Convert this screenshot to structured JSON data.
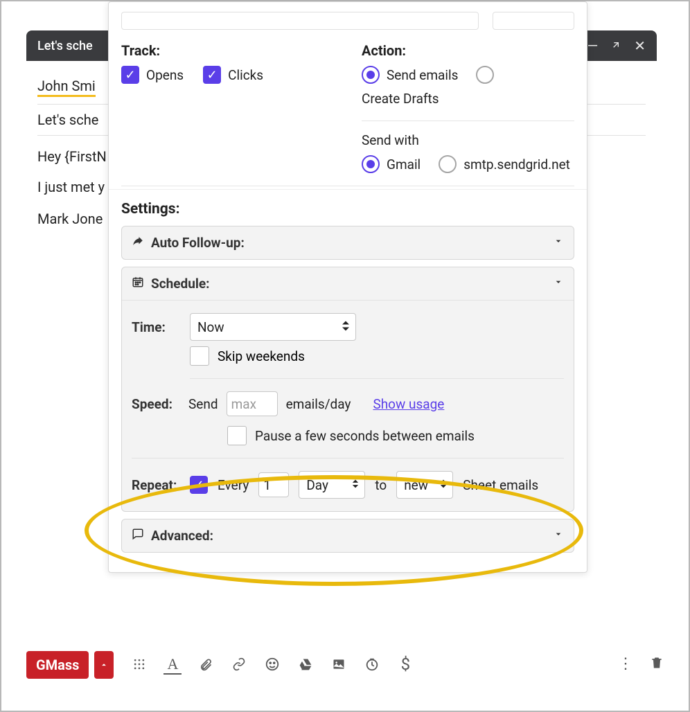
{
  "compose": {
    "subject": "Let's sche",
    "recipient": "John Smi",
    "subject_line": "Let's sche",
    "body_line1": "Hey {FirstN",
    "body_line2": "I just met y",
    "body_line3": "Mark Jone"
  },
  "panel": {
    "track": {
      "label": "Track:",
      "opens_label": "Opens",
      "clicks_label": "Clicks"
    },
    "action": {
      "label": "Action:",
      "send_emails": "Send emails",
      "create_drafts": "Create Drafts"
    },
    "sendwith": {
      "label": "Send with",
      "gmail": "Gmail",
      "smtp": "smtp.sendgrid.net"
    },
    "settings_label": "Settings:",
    "sections": {
      "autofollow": "Auto Follow-up:",
      "schedule": "Schedule:",
      "advanced": "Advanced:"
    },
    "schedule": {
      "time_label": "Time:",
      "time_value": "Now",
      "skip_label": "Skip weekends",
      "speed_label": "Speed:",
      "speed_send": "Send",
      "speed_placeholder": "max",
      "speed_suffix": "emails/day",
      "show_usage": "Show usage",
      "pause_label": "Pause a few seconds between emails",
      "repeat_label": "Repeat:",
      "every_label": "Every",
      "repeat_value": "1",
      "repeat_unit": "Day",
      "to_label": "to",
      "to_value": "new",
      "sheet_label": "Sheet emails"
    }
  },
  "toolbar": {
    "gmass": "GMass"
  }
}
